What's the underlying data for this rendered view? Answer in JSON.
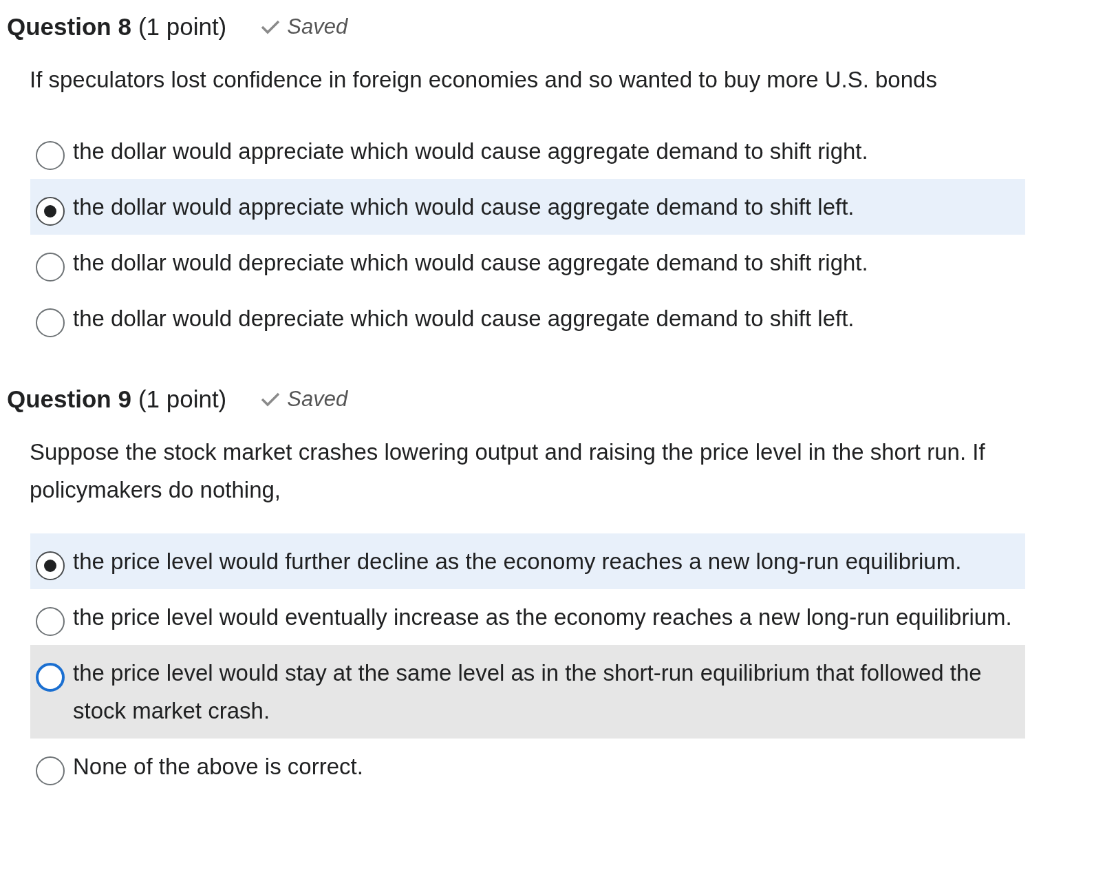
{
  "questions": [
    {
      "title": "Question 8",
      "points": "(1 point)",
      "status": "Saved",
      "prompt": "If speculators lost confidence in foreign economies and so wanted to buy more U.S. bonds",
      "options": [
        {
          "text": "the dollar would appreciate which would cause aggregate demand to shift right.",
          "selected": false,
          "hovered": false
        },
        {
          "text": "the dollar would appreciate which would cause aggregate demand to shift left.",
          "selected": true,
          "hovered": false
        },
        {
          "text": "the dollar would depreciate which would cause aggregate demand to shift right.",
          "selected": false,
          "hovered": false
        },
        {
          "text": "the dollar would depreciate which would cause aggregate demand to shift left.",
          "selected": false,
          "hovered": false
        }
      ]
    },
    {
      "title": "Question 9",
      "points": "(1 point)",
      "status": "Saved",
      "prompt": "Suppose the stock market crashes lowering output and raising the price level in the short run. If policymakers do nothing,",
      "options": [
        {
          "text": "the price level would further decline as the economy reaches a new long-run equilibrium.",
          "selected": true,
          "hovered": false
        },
        {
          "text": "the price level would eventually increase as the economy reaches a new long-run equilibrium.",
          "selected": false,
          "hovered": false
        },
        {
          "text": "the price level would stay at the same level as in the short-run equilibrium that followed the stock market crash.",
          "selected": false,
          "hovered": true
        },
        {
          "text": "None of the above is correct.",
          "selected": false,
          "hovered": false
        }
      ]
    }
  ]
}
